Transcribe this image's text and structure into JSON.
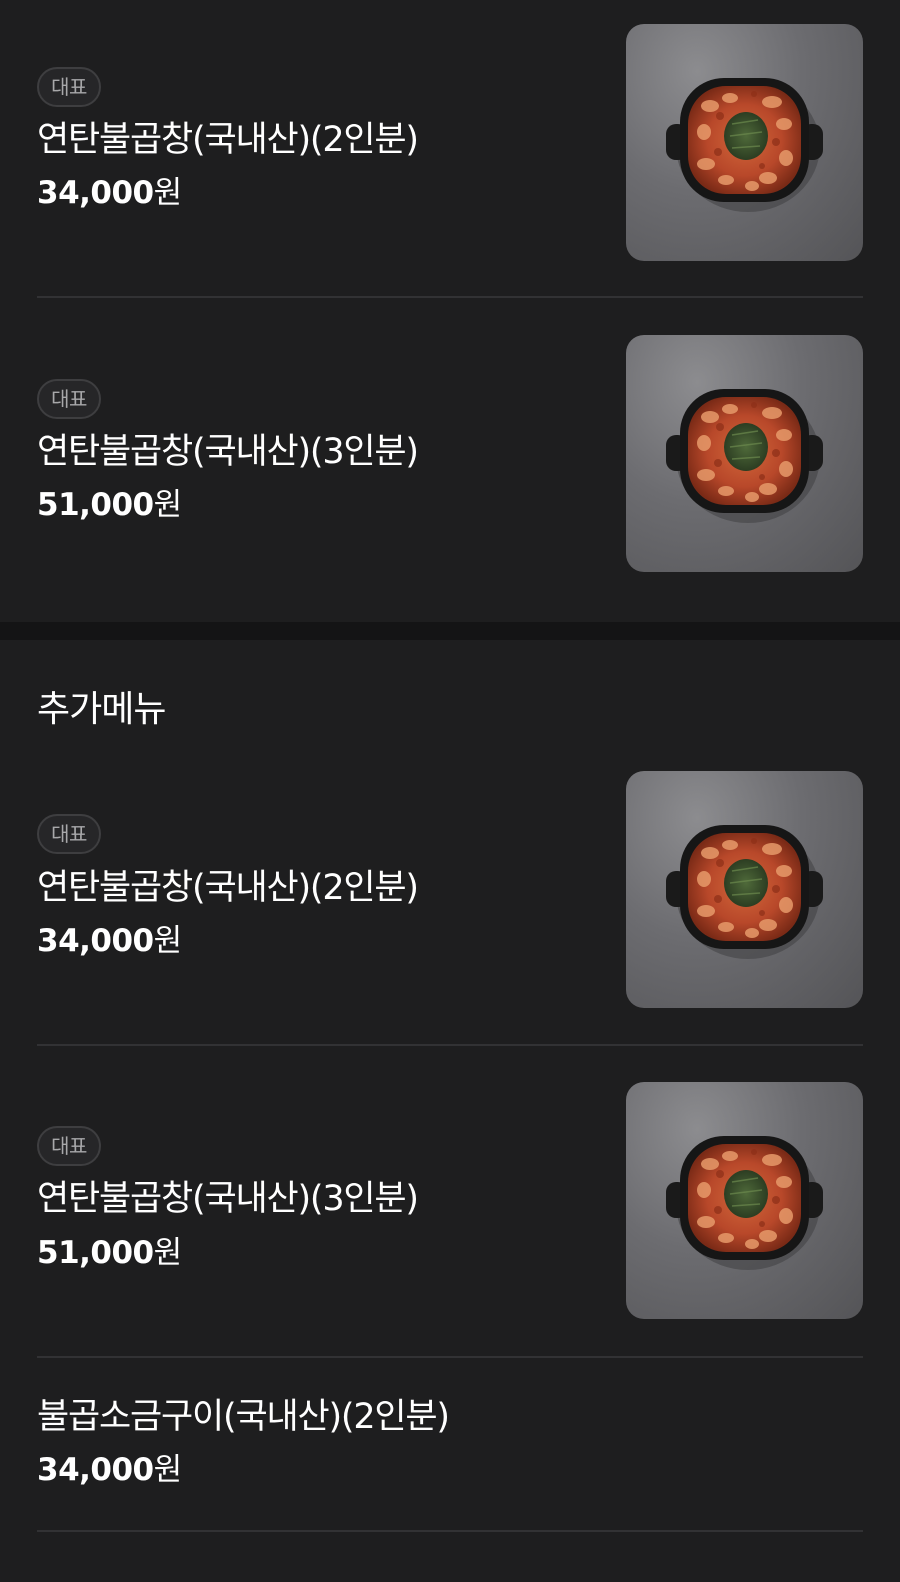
{
  "top_section": {
    "items": [
      {
        "badge": "대표",
        "name": "연탄불곱창(국내산)(2인분)",
        "price": "34,000",
        "currency": "원",
        "image": "spicy-grilled-gopchang-pan"
      },
      {
        "badge": "대표",
        "name": "연탄불곱창(국내산)(3인분)",
        "price": "51,000",
        "currency": "원",
        "image": "spicy-grilled-gopchang-pan"
      }
    ]
  },
  "extra_section": {
    "title": "추가메뉴",
    "items": [
      {
        "badge": "대표",
        "name": "연탄불곱창(국내산)(2인분)",
        "price": "34,000",
        "currency": "원",
        "image": "spicy-grilled-gopchang-pan"
      },
      {
        "badge": "대표",
        "name": "연탄불곱창(국내산)(3인분)",
        "price": "51,000",
        "currency": "원",
        "image": "spicy-grilled-gopchang-pan"
      },
      {
        "name": "불곱소금구이(국내산)(2인분)",
        "price": "34,000",
        "currency": "원"
      }
    ]
  },
  "colors": {
    "background": "#1e1e1f",
    "section_gap": "#141415",
    "badge_border": "#3e3e40",
    "badge_text": "#a8a8aa",
    "divider": "#323234"
  }
}
